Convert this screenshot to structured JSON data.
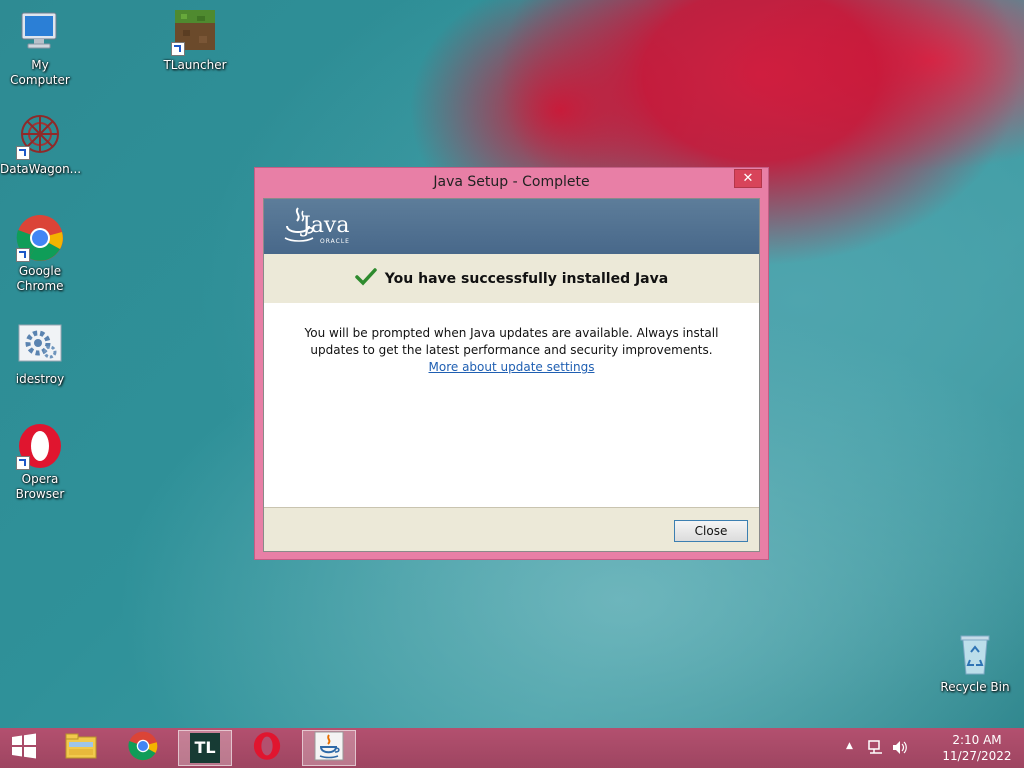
{
  "desktop": {
    "icons": [
      {
        "label": "My Computer"
      },
      {
        "label": "TLauncher"
      },
      {
        "label": "DataWagon..."
      },
      {
        "label": "Google Chrome"
      },
      {
        "label": "idestroy"
      },
      {
        "label": "Opera Browser"
      },
      {
        "label": "Recycle Bin"
      }
    ]
  },
  "dialog": {
    "title": "Java Setup - Complete",
    "close_glyph": "✕",
    "brand": {
      "name": "Java",
      "vendor": "ORACLE"
    },
    "success_message": "You have successfully installed Java",
    "body_line1": "You will be prompted when Java updates are available. Always install",
    "body_line2": "updates to get the latest performance and security improvements.",
    "link_text": "More about update settings",
    "close_button": "Close"
  },
  "taskbar": {
    "time": "2:10 AM",
    "date": "11/27/2022",
    "tl_label": "TL",
    "items": [
      "file-explorer",
      "chrome",
      "tlauncher",
      "opera",
      "java-setup"
    ]
  },
  "colors": {
    "accent": "#e87fa6",
    "taskbar": "#a84a67",
    "banner": "#4f6f90",
    "success_check": "#2e8b2e",
    "link": "#1f5fb2"
  }
}
